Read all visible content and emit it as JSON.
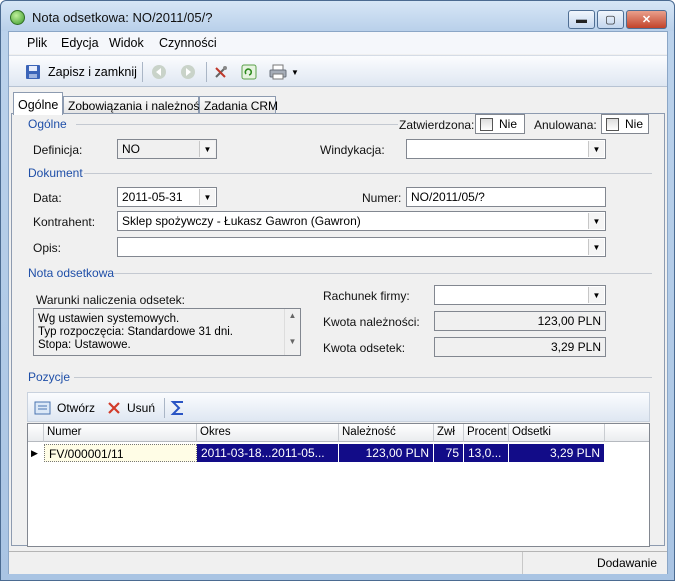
{
  "window": {
    "title": "Nota odsetkowa: NO/2011/05/?",
    "btn_min": "▬",
    "btn_max": "▢",
    "btn_close": "✕"
  },
  "menu": {
    "items": [
      "Plik",
      "Edycja",
      "Widok",
      "Czynności"
    ]
  },
  "toolbar": {
    "save_label": "Zapisz i zamknij"
  },
  "tabs": [
    "Ogólne",
    "Zobowiązania i należności",
    "Zadania CRM"
  ],
  "general": {
    "section": "Ogólne",
    "approved_label": "Zatwierdzona:",
    "approved_value": "Nie",
    "cancelled_label": "Anulowana:",
    "cancelled_value": "Nie",
    "definition_label": "Definicja:",
    "definition_value": "NO",
    "collection_label": "Windykacja:",
    "collection_value": ""
  },
  "document": {
    "section": "Dokument",
    "date_label": "Data:",
    "date_value": "2011-05-31",
    "number_label": "Numer:",
    "number_value": "NO/2011/05/?",
    "contractor_label": "Kontrahent:",
    "contractor_value": "Sklep spożywczy - Łukasz Gawron (Gawron)",
    "description_label": "Opis:",
    "description_value": ""
  },
  "note": {
    "section": "Nota odsetkowa",
    "conditions_label": "Warunki naliczenia odsetek:",
    "conditions_lines": [
      "Wg ustawien systemowych.",
      "Typ rozpoczęcia: Standardowe 31 dni.",
      "Stopa: Ustawowe."
    ],
    "account_label": "Rachunek firmy:",
    "account_value": "",
    "due_label": "Kwota należności:",
    "due_value": "123,00 PLN",
    "interest_label": "Kwota odsetek:",
    "interest_value": "3,29 PLN"
  },
  "positions": {
    "section": "Pozycje",
    "open_label": "Otwórz",
    "delete_label": "Usuń",
    "columns": [
      "Numer",
      "Okres",
      "Należność",
      "Zwł",
      "Procent",
      "Odsetki"
    ],
    "rows": [
      {
        "number": "FV/000001/11",
        "period": "2011-03-18...2011-05...",
        "due": "123,00 PLN",
        "delay": "75",
        "percent": "13,0...",
        "interest": "3,29 PLN"
      }
    ]
  },
  "status": {
    "text": "Dodawanie"
  }
}
